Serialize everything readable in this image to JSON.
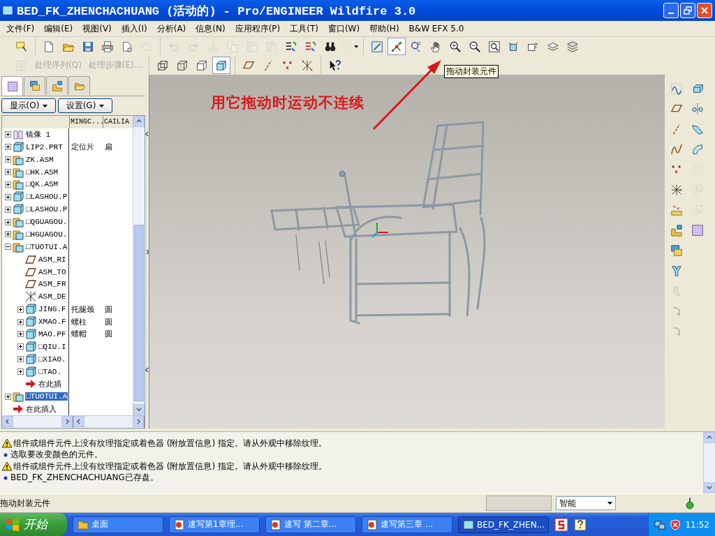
{
  "window": {
    "title": "BED_FK_ZHENCHACHUANG (活动的) - Pro/ENGINEER Wildfire 3.0"
  },
  "menu": [
    "文件(F)",
    "编辑(E)",
    "视图(V)",
    "插入(I)",
    "分析(A)",
    "信息(N)",
    "应用程序(P)",
    "工具(T)",
    "窗口(W)",
    "帮助(H)",
    "B&W EFX 5.0"
  ],
  "toolbar_1": [
    [
      {
        "disabled": false,
        "pressed": false
      }
    ],
    [
      {
        "disabled": false,
        "pressed": false
      },
      {
        "disabled": false,
        "pressed": false
      },
      {
        "disabled": false,
        "pressed": false
      },
      {
        "disabled": false,
        "pressed": false
      },
      {
        "disabled": false,
        "pressed": false
      },
      {
        "disabled": true,
        "pressed": false
      }
    ],
    [
      {
        "disabled": true,
        "pressed": false
      },
      {
        "disabled": true,
        "pressed": false
      },
      {
        "disabled": true,
        "pressed": false
      },
      {
        "disabled": true,
        "pressed": false
      },
      {
        "disabled": true,
        "pressed": false
      },
      {
        "disabled": true,
        "pressed": false
      },
      {
        "disabled": false,
        "pressed": false
      },
      {
        "disabled": false,
        "pressed": false
      },
      {
        "disabled": false,
        "pressed": false
      },
      {
        "disabled": true,
        "pressed": false
      }
    ],
    [
      {
        "disabled": false,
        "pressed": false
      },
      {
        "disabled": false,
        "pressed": true
      },
      {
        "disabled": false,
        "pressed": false
      },
      {
        "disabled": false,
        "pressed": false
      },
      {
        "disabled": false,
        "pressed": false
      },
      {
        "disabled": false,
        "pressed": false
      },
      {
        "disabled": false,
        "pressed": false
      },
      {
        "disabled": false,
        "pressed": false
      },
      {
        "disabled": false,
        "pressed": false
      },
      {
        "disabled": false,
        "pressed": false
      },
      {
        "disabled": false,
        "pressed": false
      }
    ]
  ],
  "toolbar_2": [
    [
      {
        "kind": "icon",
        "disabled": true,
        "pressed": false
      },
      {
        "kind": "text",
        "label": "处理序列(Q)",
        "disabled": true,
        "pressed": false
      },
      {
        "kind": "text",
        "label": "处理步骤(E)...",
        "disabled": true,
        "pressed": false
      }
    ],
    [
      {
        "kind": "icon",
        "disabled": false,
        "pressed": false
      },
      {
        "kind": "icon",
        "disabled": false,
        "pressed": false
      },
      {
        "kind": "icon",
        "disabled": false,
        "pressed": false
      },
      {
        "kind": "icon",
        "disabled": false,
        "pressed": true
      }
    ],
    [
      {
        "kind": "icon",
        "disabled": false,
        "pressed": false
      },
      {
        "kind": "icon",
        "disabled": false,
        "pressed": false
      },
      {
        "kind": "icon",
        "disabled": false,
        "pressed": false
      },
      {
        "kind": "icon",
        "disabled": false,
        "pressed": false
      }
    ],
    [
      {
        "kind": "icon",
        "disabled": false,
        "pressed": false
      }
    ]
  ],
  "tooltip": "拖动封装元件",
  "model_tree": {
    "tabs": [
      {
        "selected": true
      },
      {
        "selected": false
      },
      {
        "selected": false
      },
      {
        "selected": false
      }
    ],
    "buttons": [
      "显示(O)",
      "设置(G)"
    ],
    "columns": [
      "MINGC...",
      "CAILIA"
    ],
    "items": [
      {
        "name": "镜像 1",
        "kind": "mirror",
        "expanded": false,
        "selected": false
      },
      {
        "name": "LIP2.PRT",
        "kind": "part",
        "expanded": false,
        "selected": false,
        "mingc": "定位片",
        "cailiao": "扁"
      },
      {
        "name": "ZK.ASM",
        "kind": "assembly",
        "expanded": false,
        "selected": false
      },
      {
        "name": "□HK.ASM",
        "kind": "assembly",
        "expanded": false,
        "selected": false
      },
      {
        "name": "□QK.ASM",
        "kind": "assembly",
        "expanded": false,
        "selected": false
      },
      {
        "name": "□LASHOU.P",
        "kind": "part",
        "expanded": false,
        "selected": false
      },
      {
        "name": "□LASHOU.P",
        "kind": "part",
        "expanded": false,
        "selected": false
      },
      {
        "name": "□QGUAGOU.",
        "kind": "assembly",
        "expanded": false,
        "selected": false
      },
      {
        "name": "□HGUAGOU.",
        "kind": "assembly",
        "expanded": false,
        "selected": false
      },
      {
        "name": "□TUOTUI.A",
        "kind": "assembly",
        "expanded": true,
        "selected": false,
        "children": [
          {
            "name": "ASM_RI",
            "kind": "plane",
            "selected": false
          },
          {
            "name": "ASM_TO",
            "kind": "plane",
            "selected": false
          },
          {
            "name": "ASM_FR",
            "kind": "plane",
            "selected": false
          },
          {
            "name": "ASM_DE",
            "kind": "csys",
            "selected": false
          },
          {
            "name": "JING.F",
            "kind": "part",
            "expanded": false,
            "selected": false,
            "mingc": "托腿颈",
            "cailiao": "圆"
          },
          {
            "name": "XMAO.F",
            "kind": "part",
            "expanded": false,
            "selected": false,
            "mingc": "螺柱",
            "cailiao": "圆"
          },
          {
            "name": "MAO.PF",
            "kind": "part",
            "expanded": false,
            "selected": false,
            "mingc": "螺帽",
            "cailiao": "圆"
          },
          {
            "name": "□QIU.I",
            "kind": "part",
            "expanded": false,
            "selected": false
          },
          {
            "name": "□XIAO.",
            "kind": "part",
            "expanded": false,
            "selected": false
          },
          {
            "name": "□TAO.",
            "kind": "part",
            "expanded": false,
            "selected": false
          },
          {
            "name": "在此插",
            "kind": "insert",
            "selected": false
          }
        ]
      },
      {
        "name": "□TUOTUI.A",
        "kind": "assembly",
        "expanded": false,
        "selected": true
      },
      {
        "name": "在此插入",
        "kind": "insert",
        "selected": false
      }
    ]
  },
  "annotation": "用它拖动时运动不连续",
  "right_toolbar": {
    "column_1": [
      {
        "disabled": false
      },
      {
        "disabled": false
      },
      {
        "disabled": false
      },
      {
        "disabled": false
      },
      {
        "disabled": false
      },
      {
        "disabled": false
      },
      {
        "disabled": false
      },
      {
        "disabled": false
      },
      {
        "disabled": false
      },
      {
        "disabled": false
      },
      {
        "disabled": true
      },
      {
        "disabled": true
      },
      {
        "disabled": true
      }
    ],
    "column_2": [
      {
        "disabled": false
      },
      {
        "disabled": false
      },
      {
        "disabled": false
      },
      {
        "disabled": false
      },
      {
        "disabled": true
      },
      {
        "disabled": true
      },
      {
        "disabled": true
      },
      {
        "disabled": false
      }
    ]
  },
  "messages": [
    {
      "kind": "warning",
      "text": "组件或组件元件上没有纹理指定或着色器 (附放置信息) 指定。请从外观中移除纹理。"
    },
    {
      "kind": "info",
      "text": "选取要改变颜色的元件。"
    },
    {
      "kind": "warning",
      "text": "组件或组件元件上没有纹理指定或着色器 (附放置信息) 指定。请从外观中移除纹理。"
    },
    {
      "kind": "info",
      "text": "BED_FK_ZHENCHACHUANG已存盘。"
    }
  ],
  "status_bar": {
    "text": "拖动封装元件",
    "filter": "智能"
  },
  "taskbar": {
    "start": "开始",
    "tasks": [
      {
        "label": "桌面",
        "kind": "folder",
        "selected": false
      },
      {
        "label": "速写第1章理...",
        "kind": "document",
        "selected": false
      },
      {
        "label": "速写 第二章...",
        "kind": "document",
        "selected": false
      },
      {
        "label": "速写第三章 ...",
        "kind": "document",
        "selected": false
      },
      {
        "label": "BED_FK_ZHEN...",
        "kind": "proe",
        "selected": true
      }
    ],
    "clock": "11:52"
  }
}
